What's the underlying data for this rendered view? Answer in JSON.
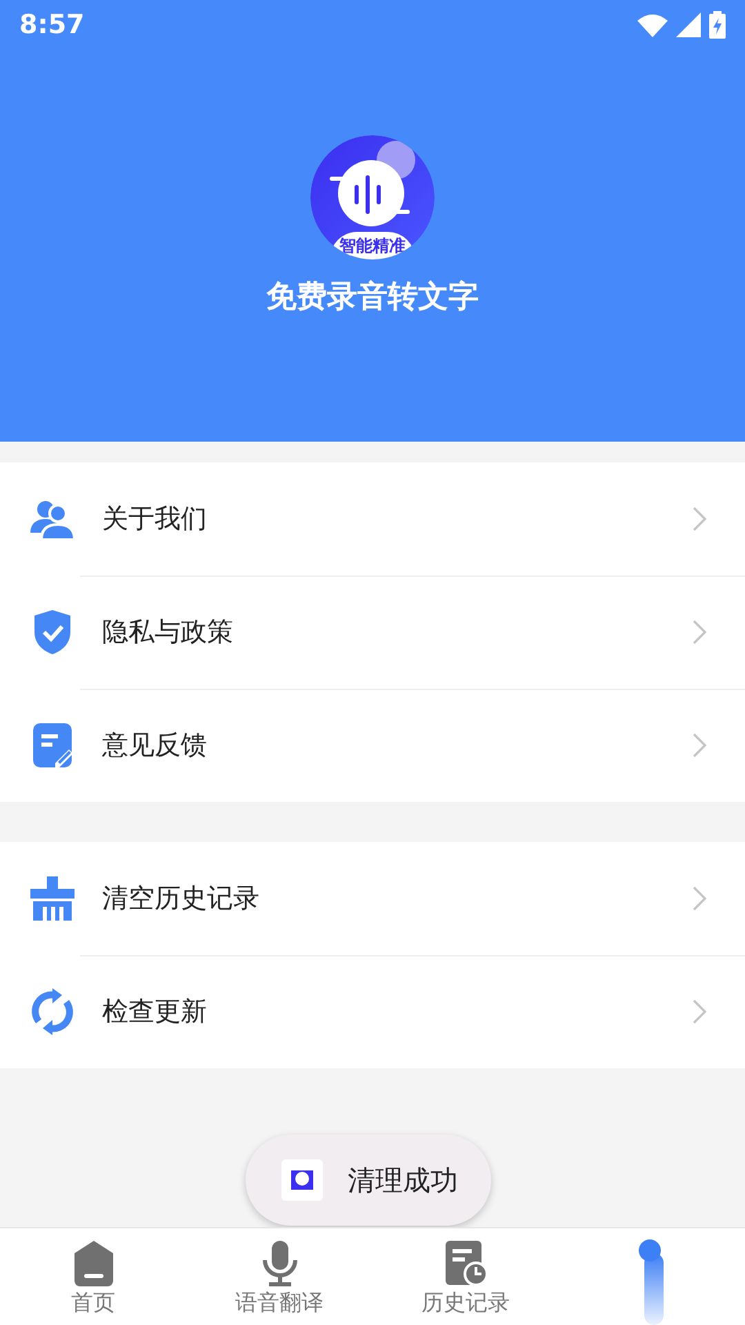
{
  "status_bar": {
    "time": "8:57"
  },
  "header": {
    "logo_badge": "智能精准",
    "title": "免费录音转文字"
  },
  "menu_groups": [
    {
      "items": [
        {
          "kind": "about",
          "label": "关于我们"
        },
        {
          "kind": "privacy",
          "label": "隐私与政策"
        },
        {
          "kind": "feedback",
          "label": "意见反馈"
        }
      ]
    },
    {
      "items": [
        {
          "kind": "clear",
          "label": "清空历史记录"
        },
        {
          "kind": "update",
          "label": "检查更新"
        }
      ]
    }
  ],
  "toast": {
    "text": "清理成功"
  },
  "bottom_nav": [
    {
      "kind": "home",
      "label": "首页",
      "selected": false
    },
    {
      "kind": "voice",
      "label": "语音翻译",
      "selected": false
    },
    {
      "kind": "history",
      "label": "历史记录",
      "selected": false
    },
    {
      "kind": "mine",
      "selected": true
    }
  ]
}
